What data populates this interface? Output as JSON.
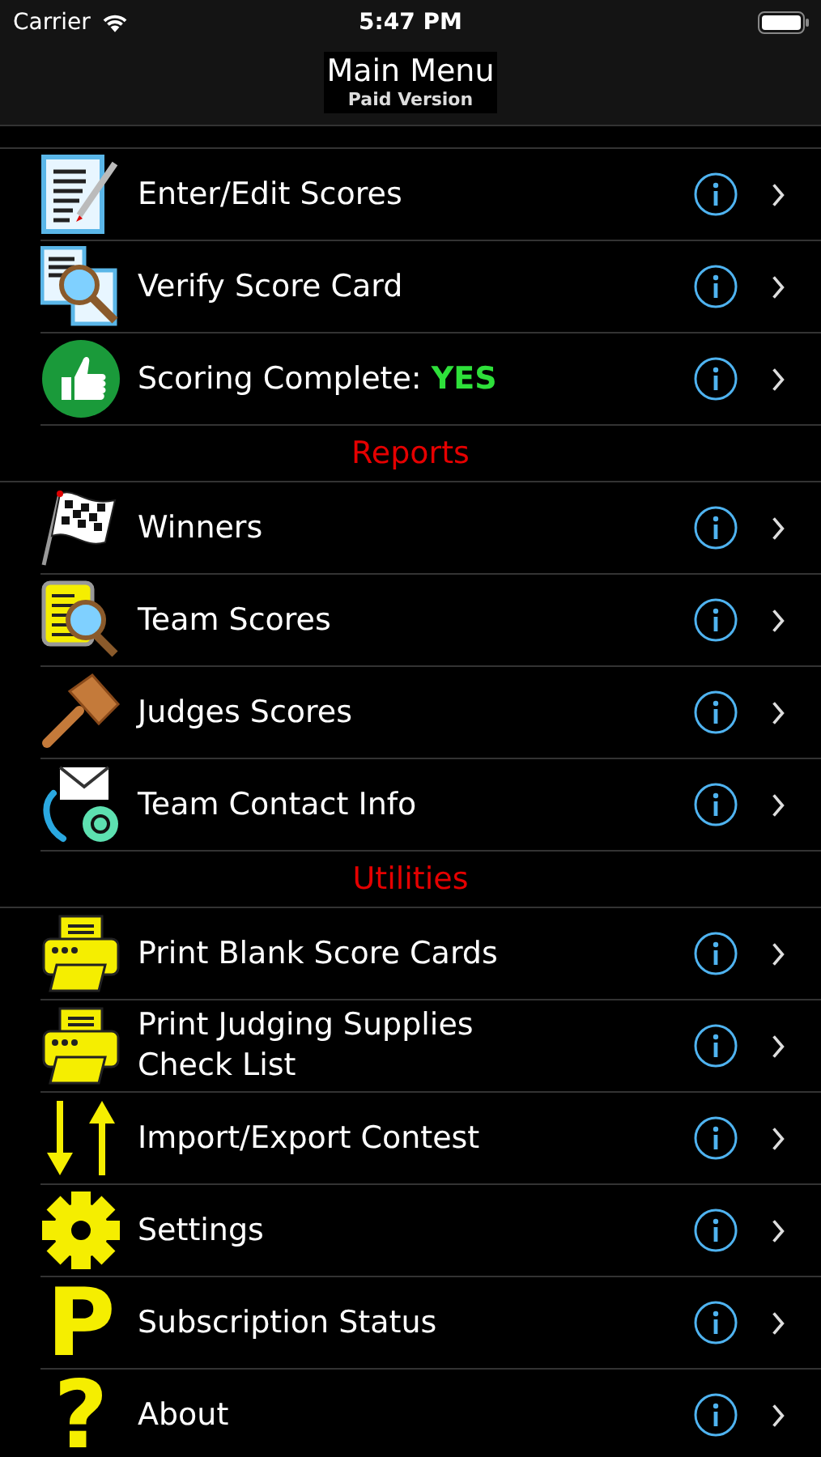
{
  "status_bar": {
    "carrier": "Carrier",
    "time": "5:47 PM"
  },
  "nav": {
    "title": "Main Menu",
    "subtitle": "Paid Version"
  },
  "sections": [
    {
      "items": [
        {
          "kind": "edit",
          "label": "Enter/Edit Scores"
        },
        {
          "kind": "verify",
          "label": "Verify Score Card"
        },
        {
          "kind": "thumb",
          "label": "Scoring Complete:",
          "value": "YES"
        }
      ]
    },
    {
      "header": "Reports",
      "items": [
        {
          "kind": "flag",
          "label": "Winners"
        },
        {
          "kind": "team",
          "label": "Team Scores"
        },
        {
          "kind": "gavel",
          "label": "Judges Scores"
        },
        {
          "kind": "contact",
          "label": "Team Contact Info"
        }
      ]
    },
    {
      "header": "Utilities",
      "items": [
        {
          "kind": "printer",
          "label": "Print Blank Score Cards"
        },
        {
          "kind": "printer",
          "label": "Print Judging Supplies Check List"
        },
        {
          "kind": "arrows",
          "label": "Import/Export Contest"
        },
        {
          "kind": "gear",
          "label": "Settings"
        },
        {
          "kind": "glyph",
          "glyph": "P",
          "label": "Subscription Status"
        },
        {
          "kind": "glyph",
          "glyph": "?",
          "label": "About"
        }
      ]
    }
  ]
}
